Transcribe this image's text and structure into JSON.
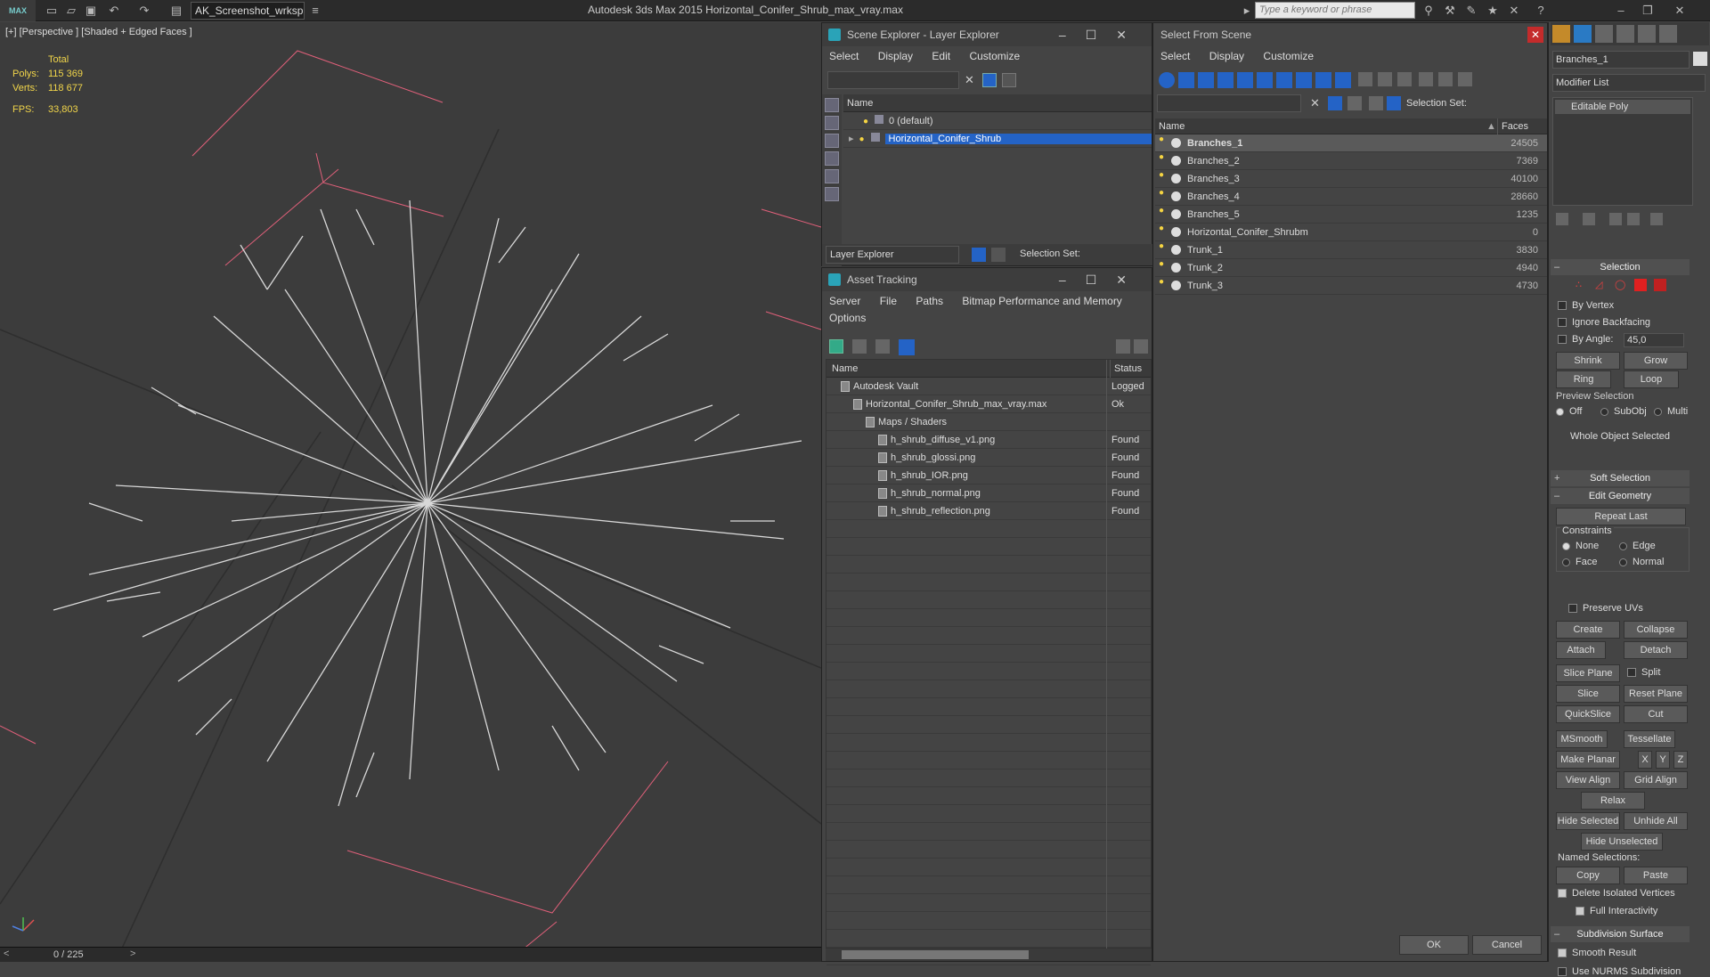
{
  "titlebar": {
    "logo": "MAX",
    "workspace": "AK_Screenshot_wrksp",
    "app_title": "Autodesk 3ds Max  2015      Horizontal_Conifer_Shrub_max_vray.max",
    "search_placeholder": "Type a keyword or phrase"
  },
  "viewport": {
    "label": "[+] [Perspective ] [Shaded + Edged Faces ]",
    "stats_total": "Total",
    "polys_label": "Polys:",
    "polys_value": "115 369",
    "verts_label": "Verts:",
    "verts_value": "118 677",
    "fps_label": "FPS:",
    "fps_value": "33,803",
    "frame_counter": "0 / 225"
  },
  "scene_explorer": {
    "title": "Scene Explorer - Layer Explorer",
    "menu": [
      "Select",
      "Display",
      "Edit",
      "Customize"
    ],
    "col_name": "Name",
    "layers": [
      {
        "name": "0 (default)",
        "selected": false
      },
      {
        "name": "Horizontal_Conifer_Shrub",
        "selected": true
      }
    ],
    "footer_dropdown": "Layer Explorer",
    "selection_set_label": "Selection Set:"
  },
  "asset_tracking": {
    "title": "Asset Tracking",
    "menu_row1": [
      "Server",
      "File",
      "Paths",
      "Bitmap Performance and Memory"
    ],
    "menu_row2": [
      "Options"
    ],
    "col_name": "Name",
    "col_status": "Status",
    "rows": [
      {
        "name": "Autodesk Vault",
        "status": "Logged",
        "indent": 0
      },
      {
        "name": "Horizontal_Conifer_Shrub_max_vray.max",
        "status": "Ok",
        "indent": 1
      },
      {
        "name": "Maps / Shaders",
        "status": "",
        "indent": 2
      },
      {
        "name": "h_shrub_diffuse_v1.png",
        "status": "Found",
        "indent": 3
      },
      {
        "name": "h_shrub_glossi.png",
        "status": "Found",
        "indent": 3
      },
      {
        "name": "h_shrub_IOR.png",
        "status": "Found",
        "indent": 3
      },
      {
        "name": "h_shrub_normal.png",
        "status": "Found",
        "indent": 3
      },
      {
        "name": "h_shrub_reflection.png",
        "status": "Found",
        "indent": 3
      }
    ]
  },
  "select_from_scene": {
    "title": "Select From Scene",
    "menu": [
      "Select",
      "Display",
      "Customize"
    ],
    "selection_set_label": "Selection Set:",
    "col_name": "Name",
    "col_faces": "Faces",
    "rows": [
      {
        "name": "Branches_1",
        "faces": "24505",
        "selected": true
      },
      {
        "name": "Branches_2",
        "faces": "7369",
        "selected": false
      },
      {
        "name": "Branches_3",
        "faces": "40100",
        "selected": false
      },
      {
        "name": "Branches_4",
        "faces": "28660",
        "selected": false
      },
      {
        "name": "Branches_5",
        "faces": "1235",
        "selected": false
      },
      {
        "name": "Horizontal_Conifer_Shrubm",
        "faces": "0",
        "selected": false
      },
      {
        "name": "Trunk_1",
        "faces": "3830",
        "selected": false
      },
      {
        "name": "Trunk_2",
        "faces": "4940",
        "selected": false
      },
      {
        "name": "Trunk_3",
        "faces": "4730",
        "selected": false
      }
    ],
    "ok": "OK",
    "cancel": "Cancel"
  },
  "command_panel": {
    "object_name": "Branches_1",
    "modifier_list": "Modifier List",
    "stack_item": "Editable Poly",
    "selection_header": "Selection",
    "by_vertex": "By Vertex",
    "ignore_backfacing": "Ignore Backfacing",
    "by_angle": "By Angle:",
    "by_angle_value": "45,0",
    "shrink": "Shrink",
    "grow": "Grow",
    "ring": "Ring",
    "loop": "Loop",
    "preview_selection": "Preview Selection",
    "preview_off": "Off",
    "preview_subobj": "SubObj",
    "preview_multi": "Multi",
    "whole_object": "Whole Object Selected",
    "soft_selection": "Soft Selection",
    "edit_geometry": "Edit Geometry",
    "repeat_last": "Repeat Last",
    "constraints": "Constraints",
    "c_none": "None",
    "c_edge": "Edge",
    "c_face": "Face",
    "c_normal": "Normal",
    "preserve_uvs": "Preserve UVs",
    "create": "Create",
    "collapse": "Collapse",
    "attach": "Attach",
    "detach": "Detach",
    "slice_plane": "Slice Plane",
    "split": "Split",
    "slice": "Slice",
    "reset_plane": "Reset Plane",
    "quickslice": "QuickSlice",
    "cut": "Cut",
    "msmooth": "MSmooth",
    "tessellate": "Tessellate",
    "make_planar": "Make Planar",
    "x": "X",
    "y": "Y",
    "z": "Z",
    "view_align": "View Align",
    "grid_align": "Grid Align",
    "relax": "Relax",
    "hide_selected": "Hide Selected",
    "unhide_all": "Unhide All",
    "hide_unselected": "Hide Unselected",
    "named_selections": "Named Selections:",
    "copy": "Copy",
    "paste": "Paste",
    "delete_isolated": "Delete Isolated Vertices",
    "full_interactivity": "Full Interactivity",
    "subdivision_surface": "Subdivision Surface",
    "smooth_result": "Smooth Result",
    "use_nurms": "Use NURMS Subdivision"
  },
  "colors": {
    "selection_blue": "#2463c6",
    "stats_yellow": "#f2d64a",
    "grid_pink": "#e0607a"
  }
}
